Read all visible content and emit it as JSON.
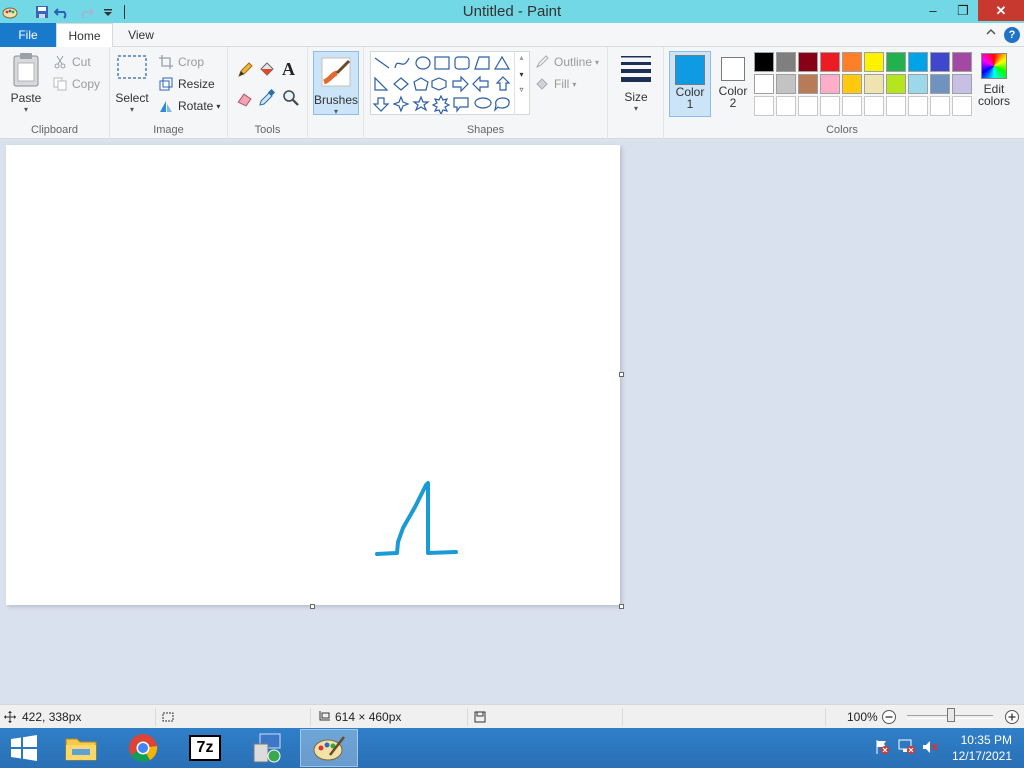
{
  "window": {
    "title": "Untitled - Paint",
    "minimize": "–",
    "maximize": "❐",
    "close": "✕"
  },
  "tabs": {
    "file": "File",
    "home": "Home",
    "view": "View",
    "help": "?"
  },
  "clipboard": {
    "label": "Clipboard",
    "paste": "Paste",
    "cut": "Cut",
    "copy": "Copy"
  },
  "image": {
    "label": "Image",
    "select": "Select",
    "crop": "Crop",
    "resize": "Resize",
    "rotate": "Rotate"
  },
  "tools": {
    "label": "Tools",
    "text_glyph": "A"
  },
  "brushes": {
    "label": "Brushes"
  },
  "shapes": {
    "label": "Shapes",
    "outline": "Outline",
    "fill": "Fill"
  },
  "size": {
    "label": "Size"
  },
  "colors": {
    "label": "Colors",
    "color1_line1": "Color",
    "color1_line2": "1",
    "color2_line1": "Color",
    "color2_line2": "2",
    "edit_line1": "Edit",
    "edit_line2": "colors",
    "color1_value": "#0f9be3",
    "color2_value": "#ffffff",
    "palette_row1": [
      "#000000",
      "#7f7f7f",
      "#880015",
      "#ed1c24",
      "#ff7f27",
      "#fff200",
      "#22b14c",
      "#00a2e8",
      "#3f48cc",
      "#a349a4"
    ],
    "palette_row2": [
      "#ffffff",
      "#c3c3c3",
      "#b97a57",
      "#ffaec9",
      "#ffc90e",
      "#efe4b0",
      "#b5e61d",
      "#99d9ea",
      "#7092be",
      "#c8bfe7"
    ],
    "palette_row3": [
      "#ffffff",
      "#ffffff",
      "#ffffff",
      "#ffffff",
      "#ffffff",
      "#ffffff",
      "#ffffff",
      "#ffffff",
      "#ffffff",
      "#ffffff"
    ]
  },
  "status": {
    "cursor_pos": "422, 338px",
    "canvas_size": "614 × 460px",
    "zoom": "100%"
  },
  "taskbar": {
    "time": "10:35 PM",
    "date": "12/17/2021",
    "seven_zip": "7z"
  },
  "stroke_color": "#1a9ad6"
}
